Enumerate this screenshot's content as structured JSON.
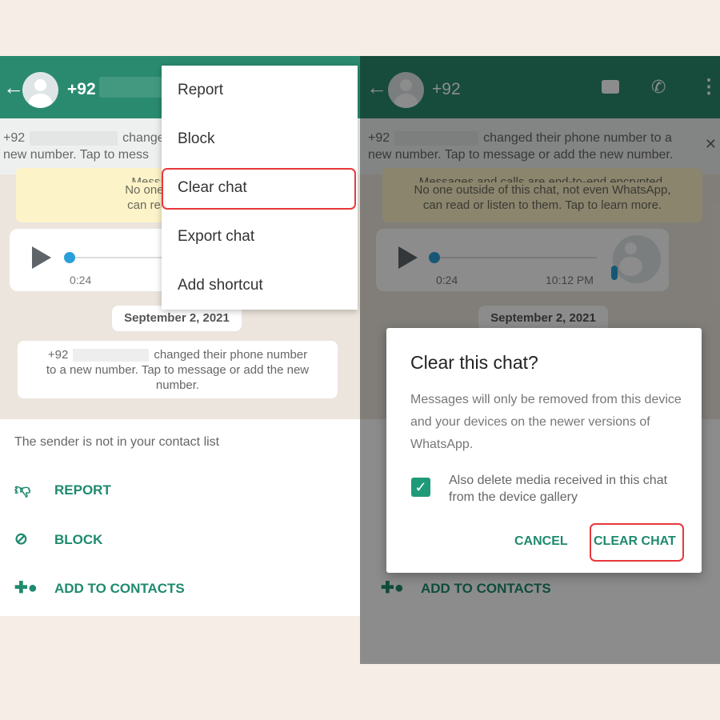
{
  "left": {
    "header": {
      "back_icon": "arrow-left",
      "number": "+92"
    },
    "banner": {
      "line1_prefix": "+92",
      "line1_suffix": "change",
      "line2": "new number. Tap to mess"
    },
    "encryption": {
      "line1": "Messages and cal",
      "line2": "No one outside of thi",
      "line3": "can read or listen to"
    },
    "voice": {
      "duration": "0:24"
    },
    "date": "September 2, 2021",
    "system_message": {
      "prefix": "+92",
      "line1": "changed their phone number",
      "line2": "to a new number. Tap to message or add the new",
      "line3": "number."
    },
    "bottom": {
      "sender_text": "The sender is not in your contact list",
      "actions": [
        {
          "icon": "thumbs-down-icon",
          "label": "REPORT"
        },
        {
          "icon": "block-icon",
          "label": "BLOCK"
        },
        {
          "icon": "add-person-icon",
          "label": "ADD TO CONTACTS"
        }
      ]
    },
    "menu": {
      "items": [
        "Report",
        "Block",
        "Clear chat",
        "Export chat",
        "Add shortcut"
      ],
      "highlighted": "Clear chat"
    }
  },
  "right": {
    "header": {
      "number": "+92",
      "icons": [
        "video-call-icon",
        "phone-icon",
        "more-vert-icon"
      ]
    },
    "banner": {
      "line1_prefix": "+92",
      "line1_suffix": "changed their phone number to a",
      "line2": "new number. Tap to message or add the new number."
    },
    "encryption": {
      "line1": "Messages and calls are end-to-end encrypted.",
      "line2": "No one outside of this chat, not even WhatsApp,",
      "line3": "can read or listen to them. Tap to learn more."
    },
    "voice": {
      "duration": "0:24",
      "time": "10:12 PM"
    },
    "date": "September 2, 2021",
    "bottom_action": "ADD TO CONTACTS",
    "dialog": {
      "title": "Clear this chat?",
      "body": "Messages will only be removed from this device and your devices on the newer versions of WhatsApp.",
      "checkbox_label": "Also delete media received in this chat from the device gallery",
      "checkbox_checked": true,
      "cancel": "CANCEL",
      "confirm": "CLEAR CHAT"
    }
  },
  "colors": {
    "header": "#2a8a6f",
    "accent": "#1e8a6e",
    "highlight": "#e8383d"
  }
}
